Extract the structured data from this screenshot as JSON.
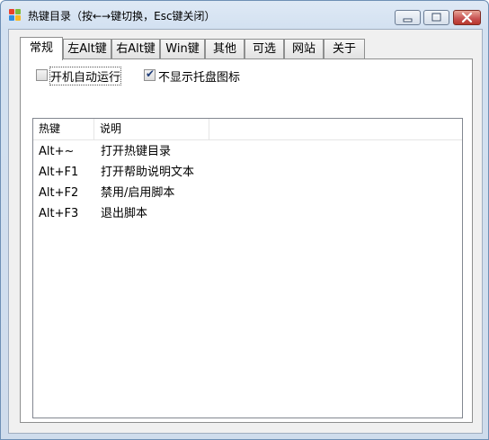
{
  "window": {
    "title": "热键目录（按←→键切换，Esc键关闭）",
    "icon": "app-grid-icon",
    "controls": {
      "minimize": "minimize-icon",
      "maximize": "maximize-icon",
      "close": "close-icon"
    }
  },
  "tabs": [
    {
      "label": "常规",
      "active": true
    },
    {
      "label": "左Alt键"
    },
    {
      "label": "右Alt键"
    },
    {
      "label": "Win键"
    },
    {
      "label": "其他"
    },
    {
      "label": "可选"
    },
    {
      "label": "网站"
    },
    {
      "label": "关于"
    }
  ],
  "options": {
    "autostart": {
      "label": "开机自动运行",
      "checked": false
    },
    "hide_tray": {
      "label": "不显示托盘图标",
      "checked": true
    }
  },
  "list": {
    "columns": [
      "热键",
      "说明"
    ],
    "rows": [
      {
        "key": "Alt+~",
        "desc": "打开热键目录"
      },
      {
        "key": "Alt+F1",
        "desc": "打开帮助说明文本"
      },
      {
        "key": "Alt+F2",
        "desc": "禁用/启用脚本"
      },
      {
        "key": "Alt+F3",
        "desc": "退出脚本"
      }
    ]
  }
}
